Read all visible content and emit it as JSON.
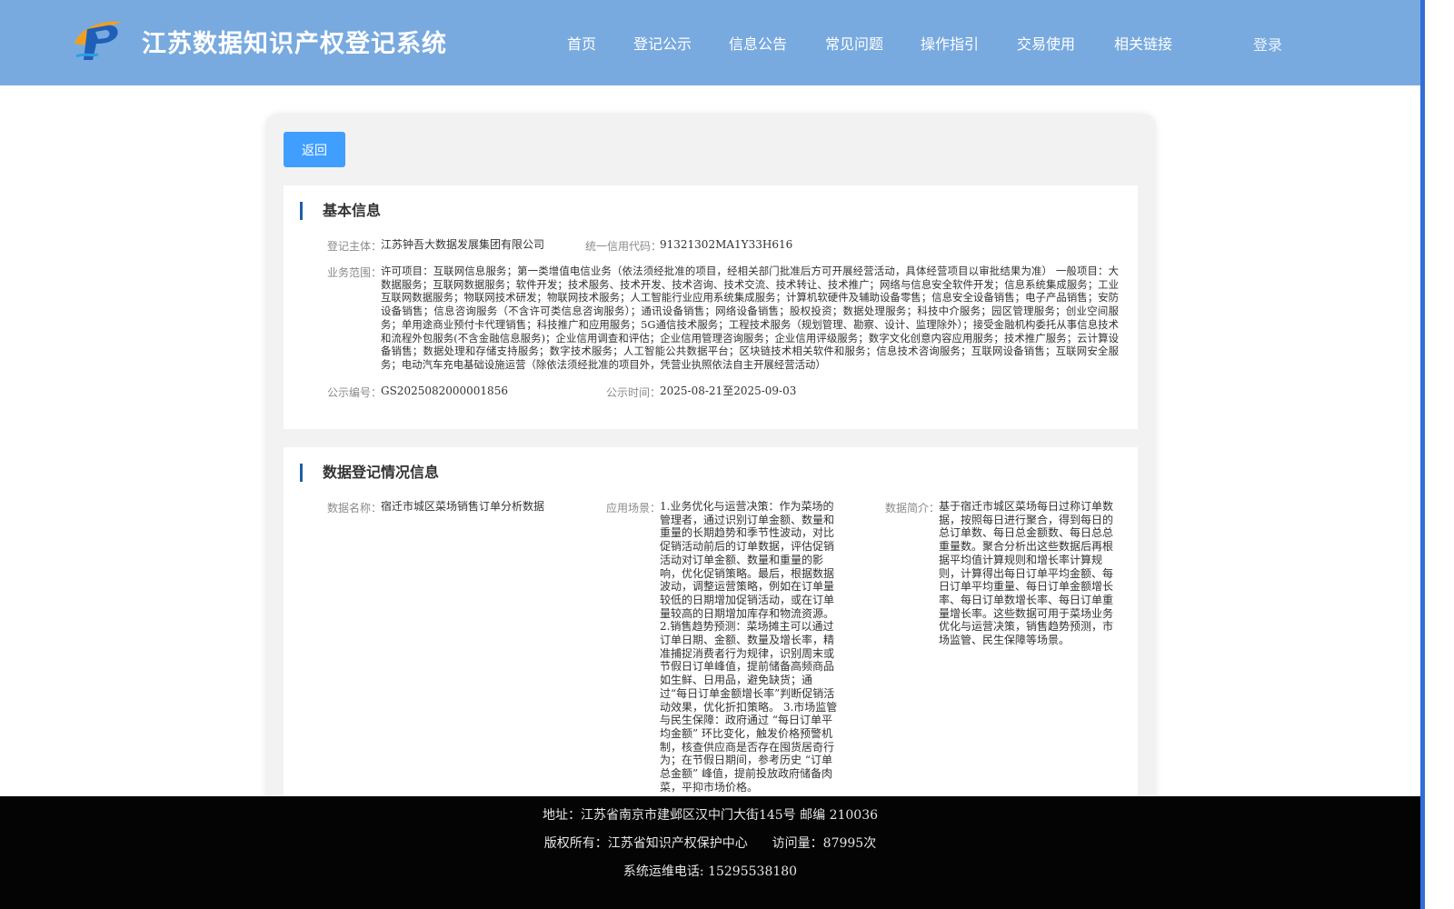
{
  "header": {
    "site_title": "江苏数据知识产权登记系统",
    "nav": [
      "首页",
      "登记公示",
      "信息公告",
      "常见问题",
      "操作指引",
      "交易使用",
      "相关链接"
    ],
    "login": "登录"
  },
  "colors": {
    "header_bg": "#78aadf",
    "button_bg": "#409eff",
    "section_bar": "#1f5fa8",
    "footer_bg": "#040404"
  },
  "back_button": "返回",
  "basic_info": {
    "title": "基本信息",
    "subject_label": "登记主体：",
    "subject_value": "江苏钟吾大数据发展集团有限公司",
    "credit_label": "统一信用代码：",
    "credit_value": "91321302MA1Y33H616",
    "scope_label": "业务范围：",
    "scope_value": "许可项目：互联网信息服务；第一类增值电信业务（依法须经批准的项目，经相关部门批准后方可开展经营活动，具体经营项目以审批结果为准） 一般项目：大数据服务；互联网数据服务；软件开发；技术服务、技术开发、技术咨询、技术交流、技术转让、技术推广；网络与信息安全软件开发；信息系统集成服务；工业互联网数据服务；物联网技术研发；物联网技术服务；人工智能行业应用系统集成服务；计算机软硬件及辅助设备零售；信息安全设备销售；电子产品销售；安防设备销售；信息咨询服务（不含许可类信息咨询服务）；通讯设备销售；网络设备销售；股权投资；数据处理服务；科技中介服务；园区管理服务；创业空间服务；单用途商业预付卡代理销售；科技推广和应用服务；5G通信技术服务；工程技术服务（规划管理、勘察、设计、监理除外）；接受金融机构委托从事信息技术和流程外包服务(不含金融信息服务)；企业信用调查和评估；企业信用管理咨询服务；企业信用评级服务；数字文化创意内容应用服务；技术推广服务；云计算设备销售；数据处理和存储支持服务；数字技术服务；人工智能公共数据平台；区块链技术相关软件和服务；信息技术咨询服务；互联网设备销售；互联网安全服务；电动汽车充电基础设施运营（除依法须经批准的项目外，凭营业执照依法自主开展经营活动）",
    "pub_no_label": "公示编号：",
    "pub_no_value": "GS2025082000001856",
    "pub_time_label": "公示时间：",
    "pub_time_value": "2025-08-21至2025-09-03"
  },
  "data_info": {
    "title": "数据登记情况信息",
    "name_label": "数据名称：",
    "name_value": "宿迁市城区菜场销售订单分析数据",
    "scene_label": "应用场景：",
    "scene_value": "1.业务优化与运营决策：作为菜场的管理者，通过识别订单金额、数量和重量的长期趋势和季节性波动，对比促销活动前后的订单数据，评估促销活动对订单金额、数量和重量的影响，优化促销策略。最后，根据数据波动，调整运营策略，例如在订单量较低的日期增加促销活动，或在订单量较高的日期增加库存和物流资源。 2.销售趋势预测：菜场摊主可以通过订单日期、金额、数量及增长率，精准捕捉消费者行为规律，识别周末或节假日订单峰值，提前储备高频商品如生鲜、日用品，避免缺货；通过“每日订单金额增长率”判断促销活动效果，优化折扣策略。 3.市场监管与民生保障：政府通过 “每日订单平均金额” 环比变化，触发价格预警机制，核查供应商是否存在囤货居奇行为；在节假日期间，参考历史 “订单总金额” 峰值，提前投放政府储备肉菜，平抑市场价格。",
    "intro_label": "数据简介：",
    "intro_value": "基于宿迁市城区菜场每日过称订单数据，按照每日进行聚合，得到每日的总订单数、每日总金额数、每日总总重量数。聚合分析出这些数据后再根据平均值计算规则和增长率计算规则，计算得出每日订单平均金额、每日订单平均重量、每日订单金额增长率、每日订单数增长率、每日订单重量增长率。这些数据可用于菜场业务优化与运营决策，销售趋势预测，市场监管、民生保障等场景。"
  },
  "footer": {
    "address": "地址：江苏省南京市建邺区汉中门大街145号 邮编 210036",
    "copyright": "版权所有：江苏省知识产权保护中心",
    "visits": "访问量：87995次",
    "phone": "系统运维电话: 15295538180"
  }
}
